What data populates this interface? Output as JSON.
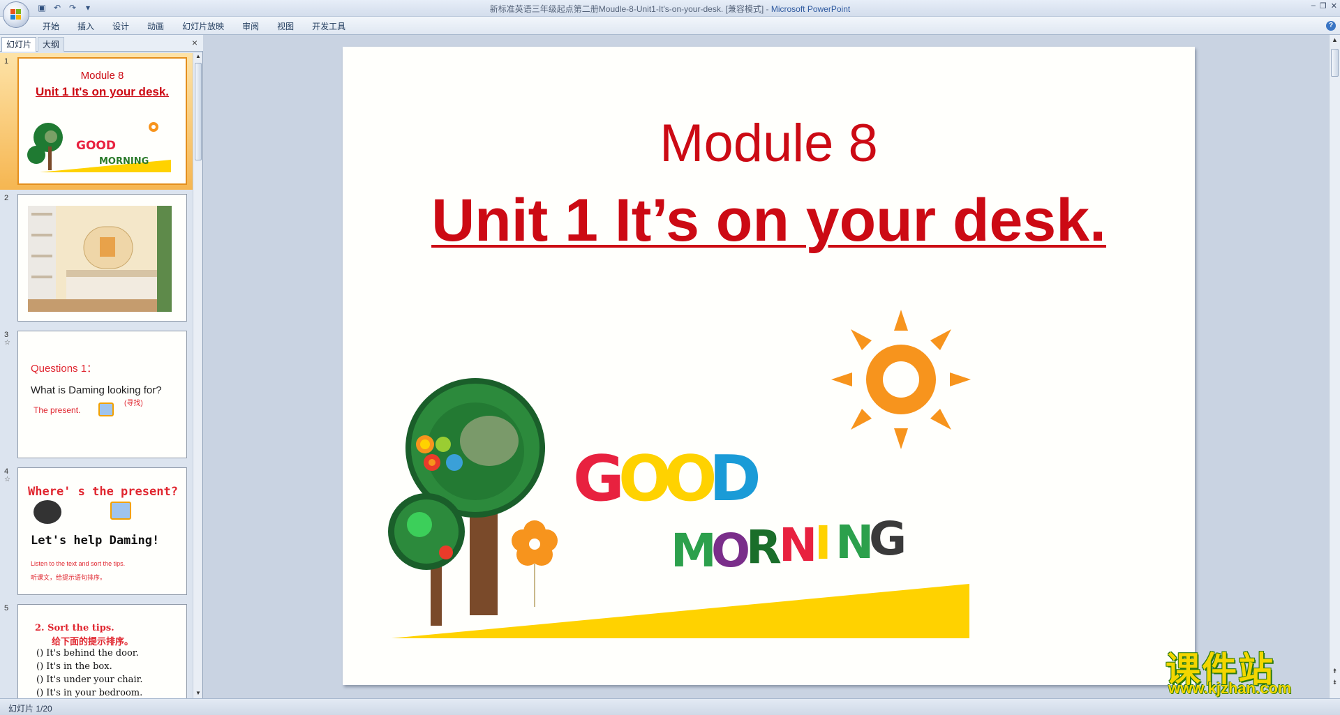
{
  "window": {
    "title": "新标准英语三年级起点第二册Moudle-8-Unit1-It's-on-your-desk. [兼容模式] - ",
    "app_name": "Microsoft PowerPoint"
  },
  "quick_access": {
    "save": "save-icon",
    "undo": "undo-icon",
    "redo": "redo-icon",
    "customize": "▾"
  },
  "menu": [
    "开始",
    "插入",
    "设计",
    "动画",
    "幻灯片放映",
    "审阅",
    "视图",
    "开发工具"
  ],
  "panel": {
    "tabs": [
      "幻灯片",
      "大纲"
    ],
    "close": "×"
  },
  "thumbnails": [
    {
      "num": "1",
      "line1": "Module 8",
      "line2": "Unit 1 It's on your desk."
    },
    {
      "num": "2"
    },
    {
      "num": "3",
      "q": "Questions 1：",
      "text": "What is Daming looking for?",
      "answer": "The present.",
      "note": "(寻找)"
    },
    {
      "num": "4",
      "title": "Where' s the present?",
      "sub": "Let's help Daming!",
      "en": "Listen to the text and sort the tips.",
      "cn": "听课文，给提示语句排序。"
    },
    {
      "num": "5",
      "title": "2. Sort the tips.",
      "cn": "给下面的提示排序。",
      "items": [
        "() It's behind the door.",
        "() It's in the box.",
        "() It's under your chair.",
        "() It's in your bedroom."
      ]
    }
  ],
  "slide": {
    "title": "Module 8",
    "subtitle": "Unit 1 It’s on your desk.",
    "art_good": [
      "G",
      "O",
      "O",
      "D"
    ],
    "art_morning": [
      "M",
      "O",
      "R",
      "N",
      "I",
      "N",
      "G"
    ]
  },
  "status": {
    "slide_info": "幻灯片 1/20"
  },
  "watermark": {
    "cn": "课件站",
    "url": "www.kjzhan.com"
  },
  "colors": {
    "accent_red": "#cc0a14",
    "selection_orange": "#f6b651",
    "ribbon_blue": "#dfe7f2"
  }
}
